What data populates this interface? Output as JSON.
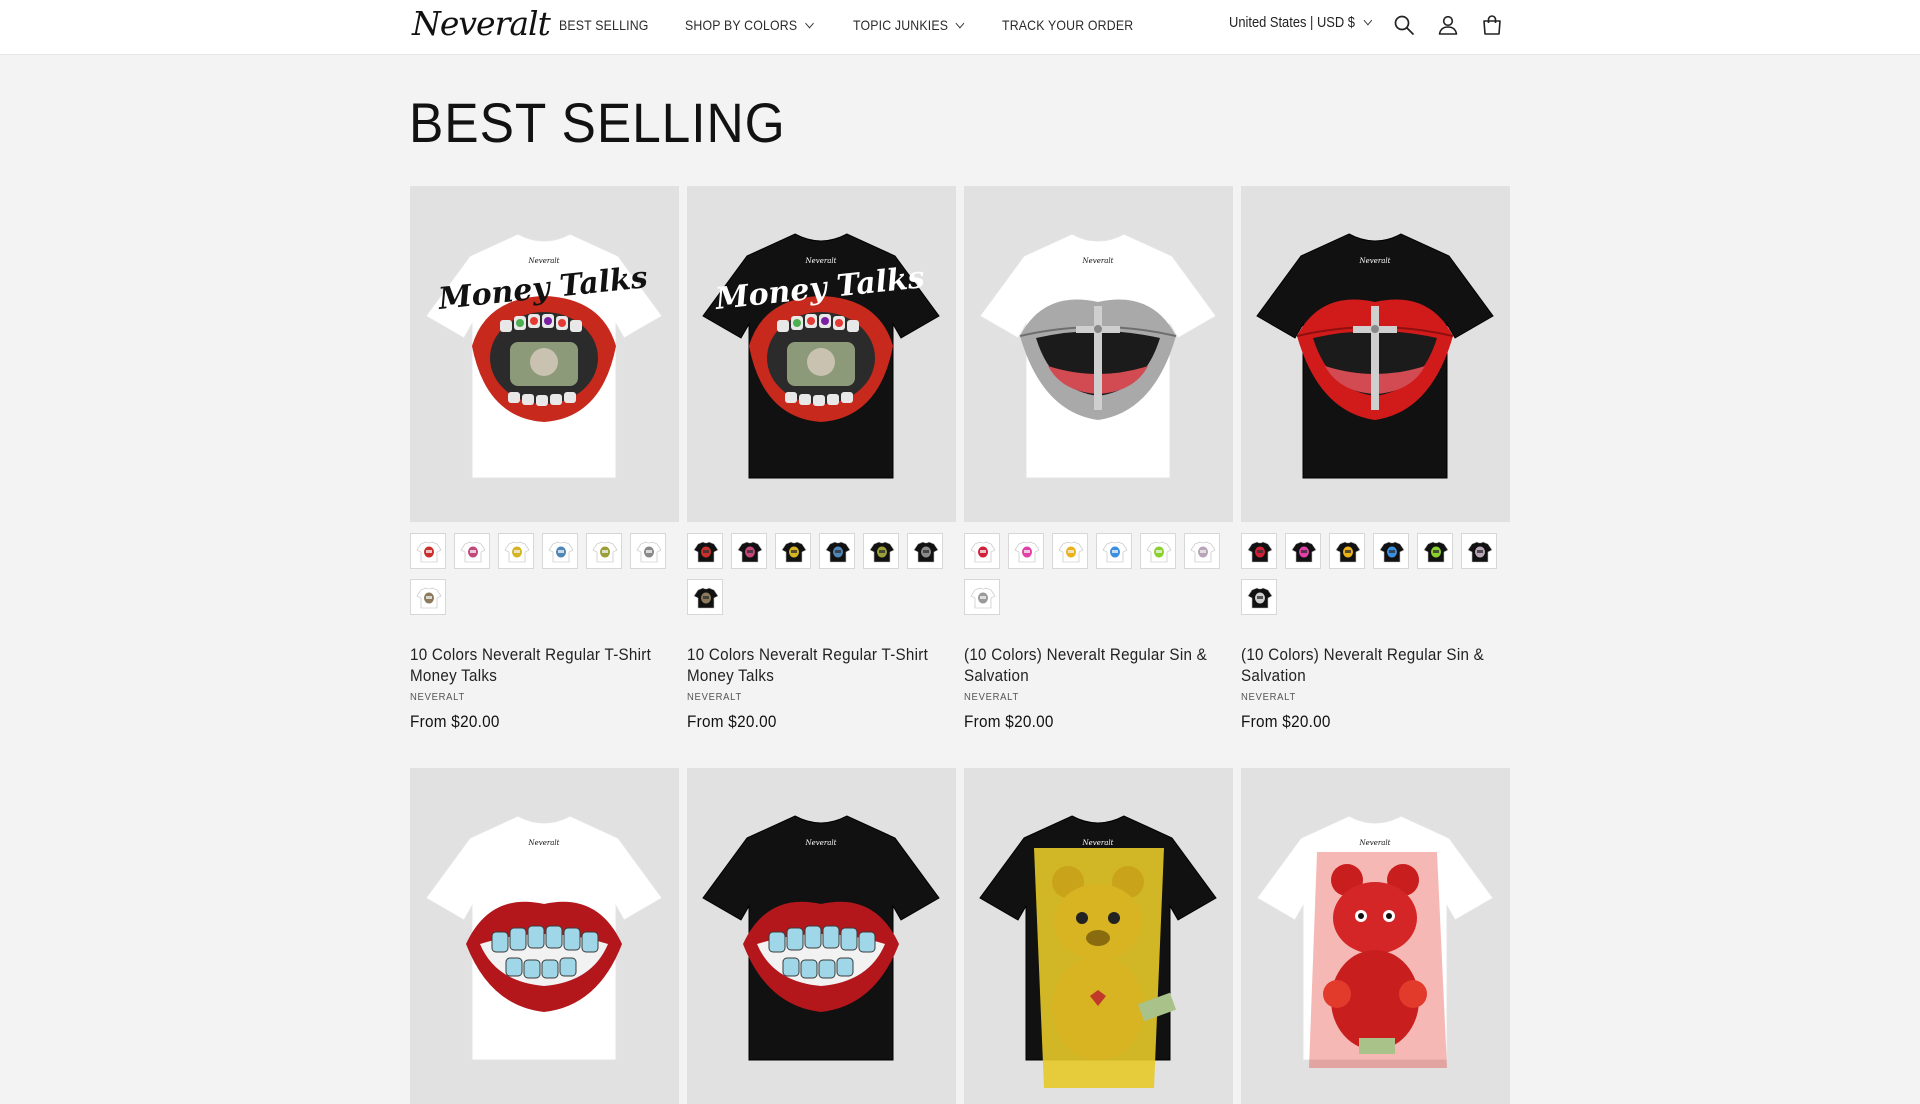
{
  "header": {
    "logo": "Neveralt",
    "nav": [
      {
        "label": "BEST SELLING",
        "has_dropdown": false
      },
      {
        "label": "SHOP BY COLORS",
        "has_dropdown": true
      },
      {
        "label": "TOPIC JUNKIES",
        "has_dropdown": true
      },
      {
        "label": "TRACK YOUR ORDER",
        "has_dropdown": false
      }
    ],
    "country": "United States | USD $",
    "icons": [
      "search-icon",
      "account-icon",
      "cart-icon"
    ]
  },
  "page_title": "BEST SELLING",
  "products": [
    {
      "title": " 10 Colors  Neveralt Regular T-Shirt Money Talks",
      "vendor": "NEVERALT",
      "price": "From $20.00",
      "shirt_color": "#ffffff",
      "design": "money-talks",
      "swatches": [
        "#c9302c",
        "#c2477a",
        "#d6b421",
        "#4f86b8",
        "#9aa037",
        "#8a8a8a",
        "#8c7a5c"
      ],
      "swatch_shirt": "#ffffff"
    },
    {
      "title": " 10 Colors  Neveralt Regular T-Shirt Money Talks",
      "vendor": "NEVERALT",
      "price": "From $20.00",
      "shirt_color": "#111111",
      "design": "money-talks",
      "swatches": [
        "#c9302c",
        "#c2477a",
        "#d6b421",
        "#4f86b8",
        "#9aa037",
        "#8a8a8a",
        "#8c7a5c"
      ],
      "swatch_shirt": "#111111"
    },
    {
      "title": "(10 Colors) Neveralt Regular Sin & Salvation",
      "vendor": "NEVERALT",
      "price": "From $20.00",
      "shirt_color": "#ffffff",
      "design": "sin-salvation-silver",
      "swatches": [
        "#d3203a",
        "#e23fa9",
        "#e9b21a",
        "#3a8fe0",
        "#8bd12e",
        "#b9a5b8",
        "#9a9a9a"
      ],
      "swatch_shirt": "#ffffff"
    },
    {
      "title": "(10 Colors) Neveralt Regular Sin & Salvation",
      "vendor": "NEVERALT",
      "price": "From $20.00",
      "shirt_color": "#111111",
      "design": "sin-salvation-red",
      "swatches": [
        "#d3203a",
        "#e23fa9",
        "#e9b21a",
        "#3a8fe0",
        "#8bd12e",
        "#b9a5b8",
        "#cfcfcf"
      ],
      "swatch_shirt": "#111111"
    },
    {
      "title": "",
      "vendor": "",
      "price": "",
      "shirt_color": "#ffffff",
      "design": "grillz-lips",
      "swatches": [],
      "swatch_shirt": "#ffffff"
    },
    {
      "title": "",
      "vendor": "",
      "price": "",
      "shirt_color": "#111111",
      "design": "grillz-lips",
      "swatches": [],
      "swatch_shirt": "#111111"
    },
    {
      "title": "",
      "vendor": "",
      "price": "",
      "shirt_color": "#111111",
      "design": "yellow-bear",
      "swatches": [],
      "swatch_shirt": "#111111"
    },
    {
      "title": "",
      "vendor": "",
      "price": "",
      "shirt_color": "#ffffff",
      "design": "red-bear",
      "swatches": [],
      "swatch_shirt": "#ffffff"
    }
  ],
  "colors": {
    "background": "#f3f3f3",
    "header_bg": "#ffffff",
    "image_bg": "#e1e1e1",
    "text": "#121212"
  }
}
